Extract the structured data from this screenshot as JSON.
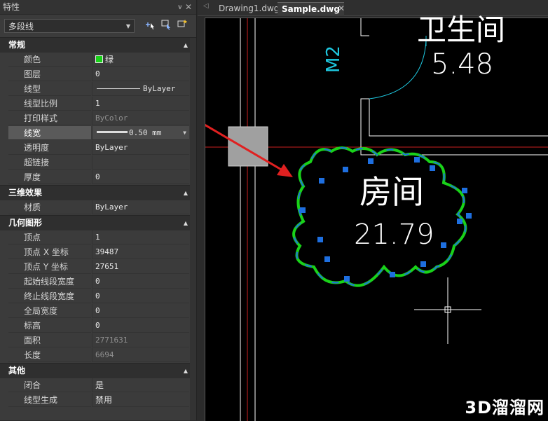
{
  "panel": {
    "title": "特性",
    "pin_icon": "pin-icon",
    "close_label": "✕",
    "object_type": "多段线",
    "tool_icons": [
      "add-to-selection-icon",
      "select-objects-icon",
      "quick-select-icon"
    ]
  },
  "sections": {
    "general": {
      "title": "常规",
      "rows": [
        {
          "name": "颜色",
          "value": "绿"
        },
        {
          "name": "图层",
          "value": "0"
        },
        {
          "name": "线型",
          "value": "ByLayer"
        },
        {
          "name": "线型比例",
          "value": "1"
        },
        {
          "name": "打印样式",
          "value": "ByColor"
        },
        {
          "name": "线宽",
          "value": "0.50 mm"
        },
        {
          "name": "透明度",
          "value": "ByLayer"
        },
        {
          "name": "超链接",
          "value": ""
        },
        {
          "name": "厚度",
          "value": "0"
        }
      ]
    },
    "three_d": {
      "title": "三维效果",
      "rows": [
        {
          "name": "材质",
          "value": "ByLayer"
        }
      ]
    },
    "geometry": {
      "title": "几何图形",
      "rows": [
        {
          "name": "顶点",
          "value": "1"
        },
        {
          "name": "顶点 X 坐标",
          "value": "39487"
        },
        {
          "name": "顶点 Y 坐标",
          "value": "27651"
        },
        {
          "name": "起始线段宽度",
          "value": "0"
        },
        {
          "name": "终止线段宽度",
          "value": "0"
        },
        {
          "name": "全局宽度",
          "value": "0"
        },
        {
          "name": "标高",
          "value": "0"
        },
        {
          "name": "面积",
          "value": "2771631"
        },
        {
          "name": "长度",
          "value": "6694"
        }
      ]
    },
    "misc": {
      "title": "其他",
      "rows": [
        {
          "name": "闭合",
          "value": "是"
        },
        {
          "name": "线型生成",
          "value": "禁用"
        }
      ]
    }
  },
  "tabs": [
    {
      "label": "Drawing1.dwg",
      "active": false
    },
    {
      "label": "Sample.dwg",
      "active": true
    }
  ],
  "drawing": {
    "room_top_name": "卫生间",
    "room_top_area": "5.48",
    "door_label": "M2",
    "room_name": "房间",
    "room_area": "21.79"
  },
  "colors": {
    "selected_polyline": "#19d219",
    "grip": "#1e6fe0",
    "arrow": "#e02020",
    "wall": "#ffffff",
    "axis": "#cc2020",
    "door_arc": "#1ec8e0"
  },
  "watermark": "3D溜溜网"
}
